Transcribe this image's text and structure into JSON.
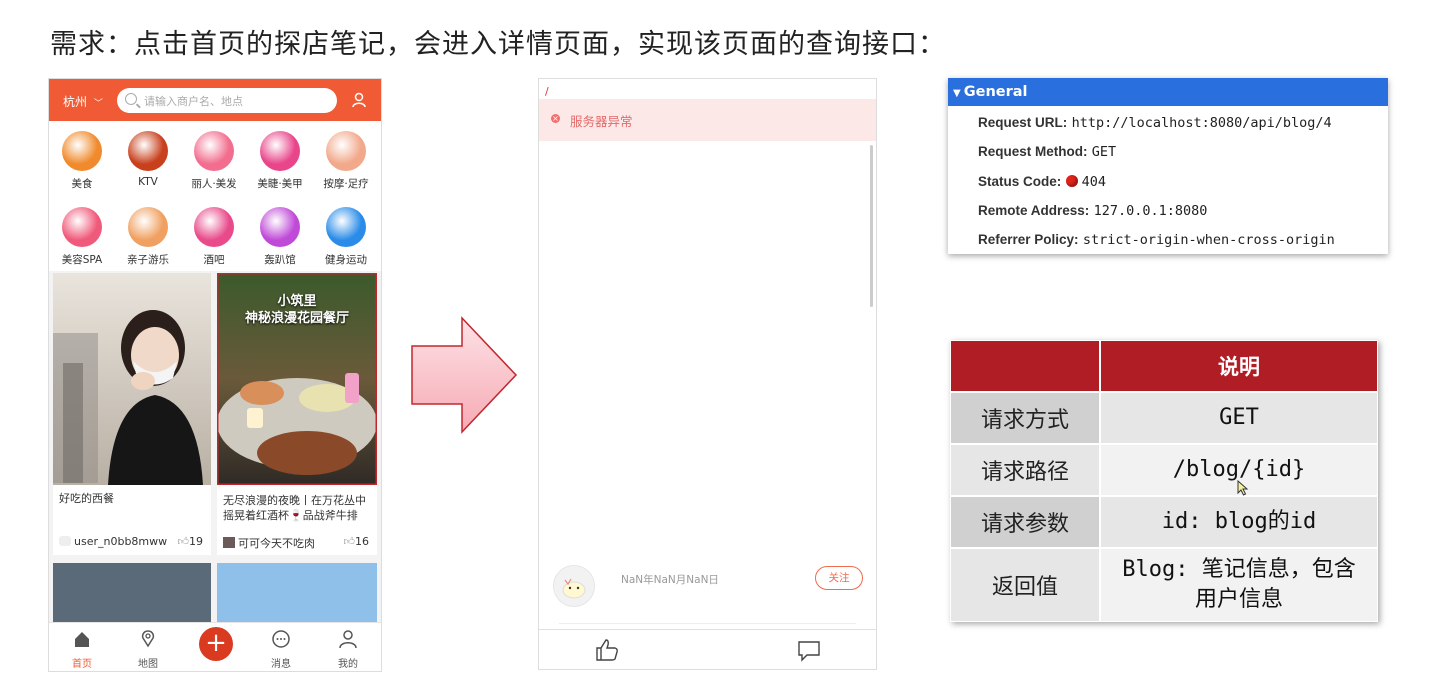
{
  "slide": {
    "title": "需求：点击首页的探店笔记，会进入详情页面，实现该页面的查询接口："
  },
  "phone1": {
    "city": "杭州",
    "search_placeholder": "请输入商户名、地点",
    "categories": [
      {
        "label": "美食",
        "icon": "roast-chicken-icon",
        "color": "#f08a2c"
      },
      {
        "label": "KTV",
        "icon": "microphone-icon",
        "color": "#c8401c"
      },
      {
        "label": "丽人·美发",
        "icon": "hair-salon-icon",
        "color": "#f26d8e"
      },
      {
        "label": "美睫·美甲",
        "icon": "nail-icon",
        "color": "#e8458a"
      },
      {
        "label": "按摩·足疗",
        "icon": "foot-massage-icon",
        "color": "#f2a88a"
      },
      {
        "label": "美容SPA",
        "icon": "face-mask-icon",
        "color": "#f05a7a"
      },
      {
        "label": "亲子游乐",
        "icon": "parent-child-icon",
        "color": "#f0a060"
      },
      {
        "label": "酒吧",
        "icon": "cocktail-icon",
        "color": "#e84a8a"
      },
      {
        "label": "轰趴馆",
        "icon": "party-mask-icon",
        "color": "#c04ad8"
      },
      {
        "label": "健身运动",
        "icon": "dumbbell-icon",
        "color": "#2a8ce8"
      }
    ],
    "cards": [
      {
        "title": "好吃的西餐",
        "user": "user_n0bb8mww",
        "likes": "19"
      },
      {
        "title": "无尽浪漫的夜晚丨在万花丛中摇晃着红酒杯🍷品战斧牛排",
        "user": "可可今天不吃肉",
        "likes": "16",
        "image_caption": "小筑里\n神秘浪漫花园餐厅"
      }
    ],
    "tabs": [
      {
        "label": "首页",
        "icon": "home-icon",
        "active": true
      },
      {
        "label": "地图",
        "icon": "map-pin-icon"
      },
      {
        "label": "",
        "icon": "plus-icon"
      },
      {
        "label": "消息",
        "icon": "message-icon"
      },
      {
        "label": "我的",
        "icon": "user-icon"
      }
    ],
    "accent": "#f05a34"
  },
  "phone2": {
    "error_text": "服务器异常",
    "date_text": "NaN年NaN月NaN日",
    "follow_label": "关注"
  },
  "general": {
    "title": "General",
    "rows": [
      {
        "key": "Request URL:",
        "value": "http://localhost:8080/api/blog/4"
      },
      {
        "key": "Request Method:",
        "value": "GET"
      },
      {
        "key": "Status Code:",
        "value": "404"
      },
      {
        "key": "Remote Address:",
        "value": "127.0.0.1:8080"
      },
      {
        "key": "Referrer Policy:",
        "value": "strict-origin-when-cross-origin"
      }
    ],
    "header_color": "#2a6fde"
  },
  "api_table": {
    "header": [
      "",
      "说明"
    ],
    "rows": [
      {
        "key": "请求方式",
        "value": "GET"
      },
      {
        "key": "请求路径",
        "value": "/blog/{id}"
      },
      {
        "key": "请求参数",
        "value": "id: blog的id"
      },
      {
        "key": "返回值",
        "value": "Blog: 笔记信息，包含用户信息"
      }
    ],
    "header_color": "#b01d24"
  }
}
